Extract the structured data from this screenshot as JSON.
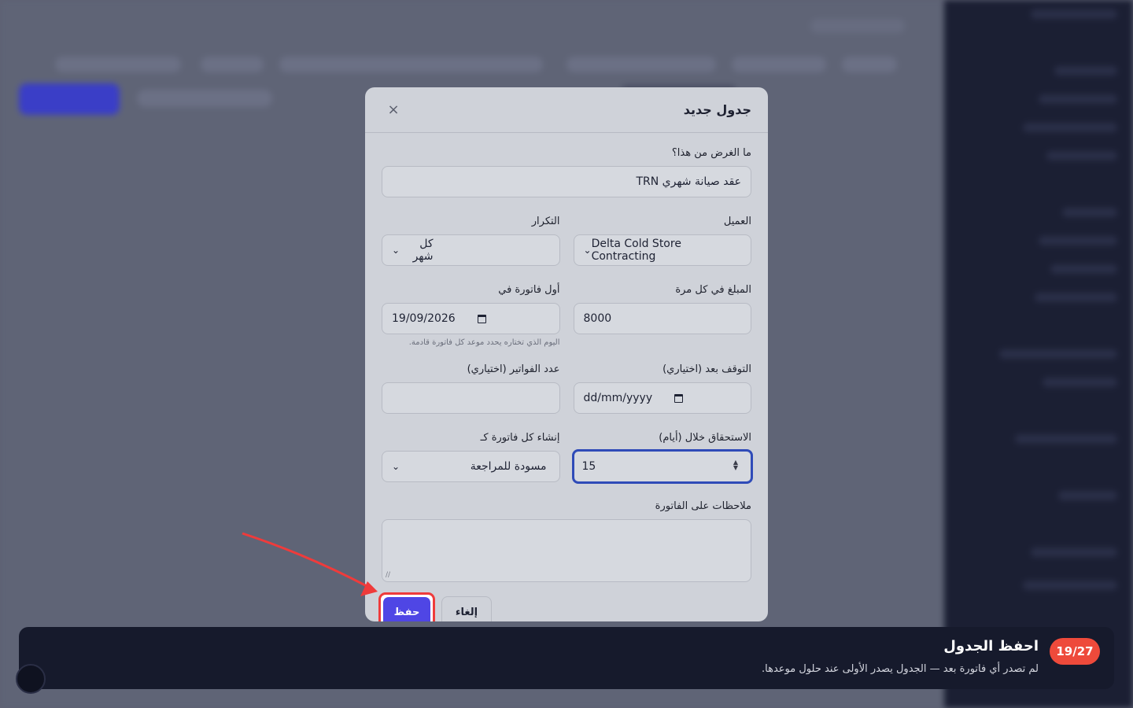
{
  "modal": {
    "title": "جدول جديد",
    "close_glyph": "×",
    "purpose": {
      "label": "ما الغرض من هذا؟",
      "value": "عقد صيانة شهري TRN"
    },
    "client": {
      "label": "العميل",
      "value": "Delta Cold Store Contracting"
    },
    "frequency": {
      "label": "التكرار",
      "value": "كل شهر"
    },
    "amount": {
      "label": "المبلغ في كل مرة",
      "value": "8000"
    },
    "first_invoice": {
      "label": "أول فاتورة في",
      "value": "19/09/2026",
      "hint": "اليوم الذي تختاره يحدد موعد كل فاتورة قادمة."
    },
    "stop_after": {
      "label": "التوقف بعد (اختياري)",
      "placeholder": "dd/mm/yyyy"
    },
    "invoice_count": {
      "label": "عدد الفواتير (اختياري)",
      "value": ""
    },
    "due_days": {
      "label": "الاستحقاق خلال (أيام)",
      "value": "15"
    },
    "create_as": {
      "label": "إنشاء كل فاتورة كـ",
      "value": "مسودة للمراجعة"
    },
    "notes": {
      "label": "ملاحظات على الفاتورة",
      "value": ""
    },
    "save_label": "حفظ",
    "cancel_label": "إلغاء"
  },
  "tour": {
    "step": "19/27",
    "title": "احفظ الجدول",
    "text": "لم تصدر أي فاتورة بعد — الجدول يصدر الأولى عند حلول موعدها."
  },
  "colors": {
    "accent": "#4f46e5",
    "highlight": "#ef3b3b",
    "tour_bg": "#161a2c",
    "badge": "#ee4a3b"
  }
}
